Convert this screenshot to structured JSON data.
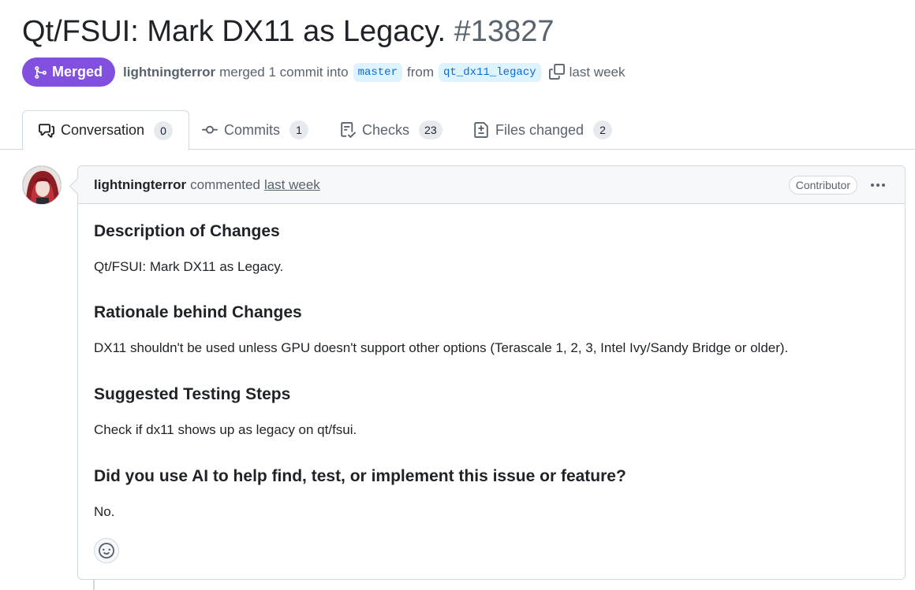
{
  "pr": {
    "title": "Qt/FSUI: Mark DX11 as Legacy.",
    "number": "#13827",
    "state": "Merged",
    "author": "lightningterror",
    "merged_text": "merged 1 commit into",
    "base_branch": "master",
    "from_text": "from",
    "head_branch": "qt_dx11_legacy",
    "time": "last week"
  },
  "tabs": [
    {
      "label": "Conversation",
      "count": "0",
      "icon": "comment-discussion-icon"
    },
    {
      "label": "Commits",
      "count": "1",
      "icon": "git-commit-icon"
    },
    {
      "label": "Checks",
      "count": "23",
      "icon": "checklist-icon"
    },
    {
      "label": "Files changed",
      "count": "2",
      "icon": "file-diff-icon"
    }
  ],
  "comment": {
    "author": "lightningterror",
    "action": "commented",
    "time": "last week",
    "role": "Contributor",
    "sections": [
      {
        "heading": "Description of Changes",
        "text": "Qt/FSUI: Mark DX11 as Legacy."
      },
      {
        "heading": "Rationale behind Changes",
        "text": "DX11 shouldn't be used unless GPU doesn't support other options (Terascale 1, 2, 3, Intel Ivy/Sandy Bridge or older)."
      },
      {
        "heading": "Suggested Testing Steps",
        "text": "Check if dx11 shows up as legacy on qt/fsui."
      },
      {
        "heading": "Did you use AI to help find, test, or implement this issue or feature?",
        "text": "No."
      }
    ]
  },
  "colors": {
    "merged": "#8250df",
    "branch_bg": "#ddf4ff",
    "branch_fg": "#0969da",
    "muted": "#59636e"
  }
}
